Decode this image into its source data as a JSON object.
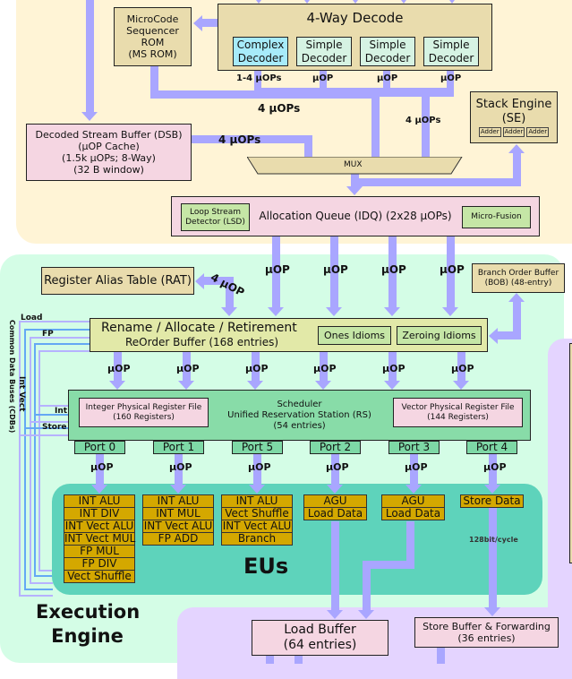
{
  "front_end": {
    "decode": {
      "title": "4-Way Decode",
      "decoders": [
        {
          "line1": "Complex",
          "line2": "Decoder"
        },
        {
          "line1": "Simple",
          "line2": "Decoder"
        },
        {
          "line1": "Simple",
          "line2": "Decoder"
        },
        {
          "line1": "Simple",
          "line2": "Decoder"
        }
      ],
      "outputs": [
        "1-4 µOPs",
        "µOP",
        "µOP",
        "µOP"
      ]
    },
    "ms_rom": {
      "line1": "MicroCode",
      "line2": "Sequencer",
      "line3": "ROM",
      "line4": "(MS ROM)"
    },
    "dsb": {
      "line1": "Decoded Stream Buffer (DSB)",
      "line2": "(µOP Cache)",
      "line3": "(1.5k µOPs; 8-Way)",
      "line4": "(32 B window)"
    },
    "stack_engine": {
      "line1": "Stack Engine",
      "line2": "(SE)",
      "adders": [
        "Adder",
        "Adder",
        "Adder"
      ]
    },
    "mux": "MUX",
    "labels": {
      "msrom_to_mux": "4 µOPs",
      "dsb_to_mux": "4 µOPs",
      "decode_to_mux": "4 µOPs"
    },
    "idq": {
      "title": "Allocation Queue (IDQ) (2x28 µOPs)",
      "lsd_line1": "Loop Stream",
      "lsd_line2": "Detector (LSD)",
      "micro_fusion": "Micro-Fusion"
    }
  },
  "execution_engine": {
    "title_line1": "Execution",
    "title_line2": "Engine",
    "rat": "Register Alias Table (RAT)",
    "rat_label": "4 µOP",
    "bob": {
      "line1": "Branch Order Buffer",
      "line2": "(BOB) (48-entry)"
    },
    "idq_outputs": [
      "µOP",
      "µOP",
      "µOP",
      "µOP"
    ],
    "rob": {
      "line1": "Rename / Allocate / Retirement",
      "line2": "ReOrder Buffer (168 entries)",
      "ones_idioms": "Ones Idioms",
      "zeroing_idioms": "Zeroing Idioms"
    },
    "rob_outputs": [
      "µOP",
      "µOP",
      "µOP",
      "µOP",
      "µOP",
      "µOP"
    ],
    "scheduler": {
      "line1": "Scheduler",
      "line2": "Unified Reservation Station (RS)",
      "line3": "(54 entries)",
      "int_prf_line1": "Integer Physical Register File",
      "int_prf_line2": "(160 Registers)",
      "vec_prf_line1": "Vector Physical Register File",
      "vec_prf_line2": "(144 Registers)"
    },
    "ports": [
      "Port 0",
      "Port 1",
      "Port 5",
      "Port 2",
      "Port 3",
      "Port 4"
    ],
    "port_outputs": [
      "µOP",
      "µOP",
      "µOP",
      "µOP",
      "µOP",
      "µOP"
    ],
    "eus_title": "EUs",
    "eu_columns": [
      [
        "INT ALU",
        "INT DIV",
        "INT Vect ALU",
        "INT Vect MUL",
        "FP MUL",
        "FP DIV",
        "Vect Shuffle"
      ],
      [
        "INT ALU",
        "INT MUL",
        "INT Vect ALU",
        "FP ADD"
      ],
      [
        "INT ALU",
        "Vect Shuffle",
        "INT Vect ALU",
        "Branch"
      ],
      [
        "AGU",
        "Load Data"
      ],
      [
        "AGU",
        "Load Data"
      ],
      [
        "Store Data"
      ]
    ],
    "store_bandwidth": "128bit/cycle",
    "cdb": {
      "title": "Common Data Buses (CDBs)",
      "load": "Load",
      "fp": "FP",
      "int_vect": "Int Vect",
      "int": "Int",
      "store": "Store"
    }
  },
  "memory": {
    "load_buffer": {
      "line1": "Load Buffer",
      "line2": "(64 entries)"
    },
    "store_buffer": {
      "line1": "Store Buffer & Forwarding",
      "line2": "(36 entries)"
    }
  },
  "colors": {
    "front_end_bg": "#fff4d6",
    "execution_bg": "#d4fde6",
    "memory_bg": "#e4d4ff",
    "eus_bg": "#5ed3bb",
    "arrow": "#a9a6ff",
    "eu_unit": "#d4a800"
  }
}
